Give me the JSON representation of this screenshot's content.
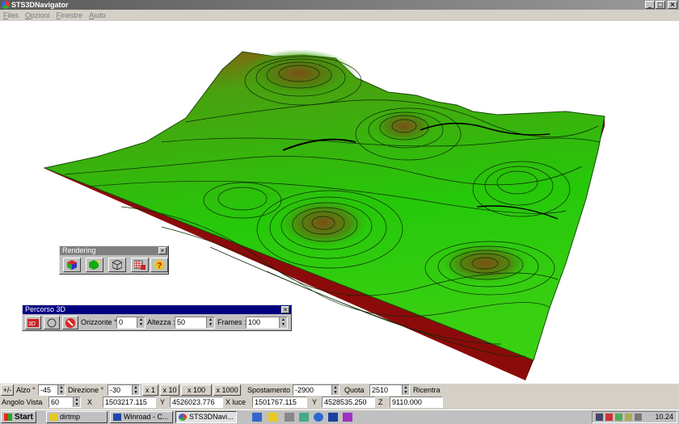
{
  "window": {
    "title": "STS3DNavigator",
    "controls": [
      "_",
      "□",
      "×"
    ]
  },
  "menu": [
    "Files",
    "Opzioni",
    "Finestre",
    "Aiuto"
  ],
  "colors": {
    "terrain_low": "#22c20a",
    "terrain_high": "#8a4a14",
    "base_side": "#8b0a0a",
    "title_active": "#000080"
  },
  "rendering": {
    "title": "Rendering",
    "close": "×"
  },
  "percorso": {
    "title": "Percorso 3D",
    "close": "×",
    "orizzonte_label": "Orizzonte °",
    "orizzonte_value": "0",
    "altezza_label": "Altezza :",
    "altezza_value": "50",
    "frames_label": "Frames :",
    "frames_value": "100"
  },
  "controls": {
    "pm": "+/-",
    "alzo_label": "Alzo °",
    "alzo_value": "-45",
    "direzione_label": "Direzione °",
    "direzione_value": "-30",
    "x1": "x 1",
    "x10": "x 10",
    "x100": "x 100",
    "x1000": "x 1000",
    "spostamento_label": "Spostamento",
    "spostamento_value": "-2900",
    "quota_label": "Quota",
    "quota_value": "2510",
    "ricentra": "Ricentra",
    "angolo_label": "Angolo Vista",
    "angolo_value": "60",
    "x_label": "X",
    "x_value": "1503217.115",
    "y_label": "Y",
    "y_value": "4526023.776",
    "xluce_label": "X luce",
    "xluce_value": "1501767.115",
    "yluce_label": "Y",
    "yluce_value": "4528535.250",
    "z_label": "Z",
    "z_value": "9110.000"
  },
  "taskbar": {
    "start": "Start",
    "tasks": [
      "dirtmp",
      "Winroad - C...",
      "STS3DNavi..."
    ],
    "clock": "10.24"
  }
}
